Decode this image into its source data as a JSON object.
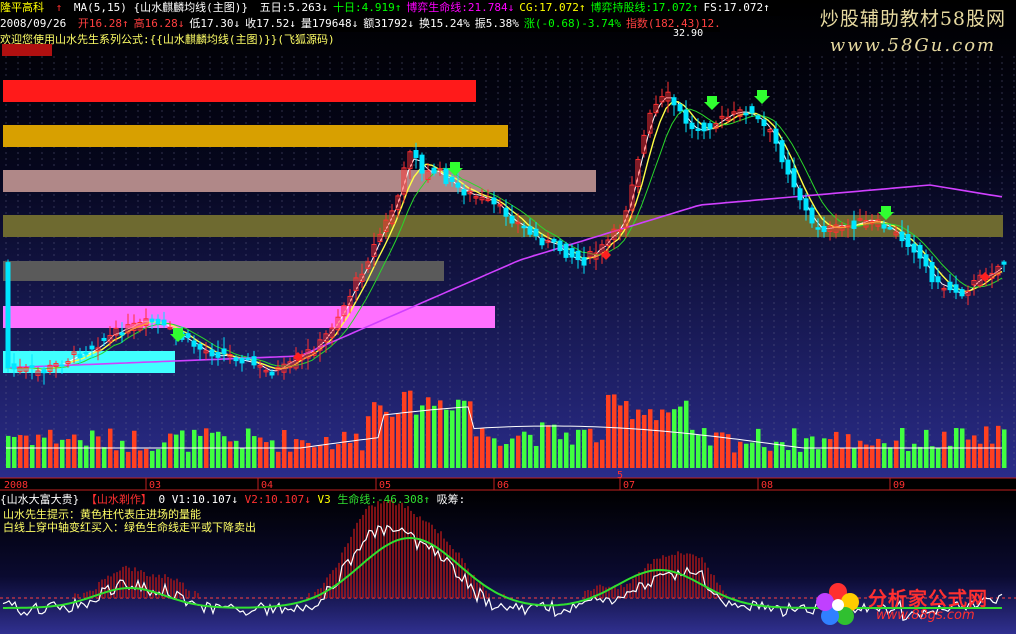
{
  "header": {
    "stock_name": "隆平高科",
    "indicator_title": "MA(5,15) {山水麒麟均线(主图)}",
    "segments": [
      {
        "text": "五日:5.263↓",
        "color": "#ffffff"
      },
      {
        "text": "十日:4.919↑",
        "color": "#00ff00"
      },
      {
        "text": "博弈生命线:21.784↓",
        "color": "#ff00ff"
      },
      {
        "text": "CG:17.072↑",
        "color": "#ffff00"
      },
      {
        "text": "博弈持股线:17.072↑",
        "color": "#00ff00"
      },
      {
        "text": "FS:17.072↑",
        "color": "#ffffff"
      }
    ],
    "price_date": "2008/09/26",
    "price_segments": [
      {
        "text": "开16.28↑",
        "color": "#ff4040"
      },
      {
        "text": "高16.28↓",
        "color": "#ff4040"
      },
      {
        "text": "低17.30↓",
        "color": "#ffffff"
      },
      {
        "text": "收17.52↓",
        "color": "#ffffff"
      },
      {
        "text": "量179648↓",
        "color": "#ffffff"
      },
      {
        "text": "额31792↓",
        "color": "#ffffff"
      },
      {
        "text": "换15.24%",
        "color": "#ffffff"
      },
      {
        "text": "振5.38%",
        "color": "#ffffff"
      },
      {
        "text": "涨(-0.68)-3.74%",
        "color": "#00ff00"
      },
      {
        "text": "指数(182.43)12.47%",
        "color": "#ff4040"
      }
    ],
    "welcome": "欢迎您使用山水先生系列公式:{{山水麒麟均线(主图)}}(飞狐源码)",
    "top_price": "32.90"
  },
  "watermark": {
    "line1": "炒股辅助教材58股网",
    "line2": "www.58Gu.com"
  },
  "x_axis": {
    "year_label": "2008",
    "months": [
      "03",
      "04",
      "05",
      "06",
      "07",
      "08",
      "09"
    ],
    "month_marker": "5"
  },
  "sub_panel": {
    "title": "{山水大富大贵}",
    "author": "【山水剃作】",
    "marker": "0",
    "v1": "V1:10.107↓",
    "v2": "V2:10.107↓",
    "v3": "V3",
    "lifeline": "生命线:-46.308↑",
    "absorb": "吸筹:"
  },
  "tips": {
    "line1": "山水先生提示：黄色柱代表庄进场的量能",
    "line2": "白线上穿中轴变红买入：绿色生命线走平或下降卖出"
  },
  "logo": {
    "name": "分析家公式网",
    "url": "www.88gs.com"
  },
  "colors": {
    "up": "#ff3030",
    "down": "#00e5ff",
    "ma_yellow": "#ffff44",
    "ma_purple": "#d040ff",
    "vol_up": "#ff4020",
    "vol_down": "#40ff40",
    "sub_green": "#30e030",
    "sub_bars": "#b01818"
  }
}
